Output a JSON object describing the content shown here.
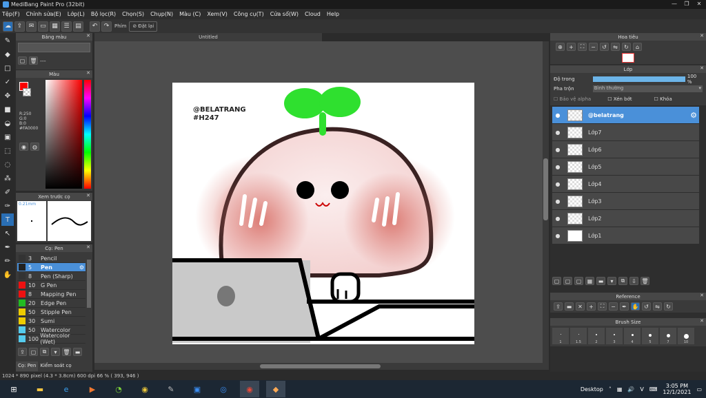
{
  "app": {
    "title": "MediBang Paint Pro (32bit)"
  },
  "menu": [
    "Tệp(F)",
    "Chỉnh sửa(E)",
    "Lớp(L)",
    "Bộ lọc(R)",
    "Chọn(S)",
    "Chụp(N)",
    "Màu (C)",
    "Xem(V)",
    "Công cụ(T)",
    "Cửa sổ(W)",
    "Cloud",
    "Help"
  ],
  "toolbar": {
    "phim_label": "Phím",
    "reset_label": "Đặt lại"
  },
  "document": {
    "tab_title": "Untitled"
  },
  "artwork": {
    "caption_line1": "@BELATRANG",
    "caption_line2": "#H247"
  },
  "panels": {
    "palette": {
      "title": "Bảng màu",
      "dash": "---"
    },
    "color": {
      "title": "Màu",
      "r": "R:250",
      "g": "G:0",
      "b": "B:0",
      "hex": "#FA0000",
      "main_color": "#fa0000"
    },
    "brush_preview": {
      "title": "Xem trước cọ",
      "size": "0.21mm"
    },
    "brush": {
      "title": "Cọ: Pen",
      "tab_brush": "Cọ: Pen",
      "tab_control": "Kiểm soát cọ",
      "items": [
        {
          "size": "3",
          "name": "Pencil",
          "color": "#333333"
        },
        {
          "size": "5",
          "name": "Pen",
          "color": "#222222"
        },
        {
          "size": "8",
          "name": "Pen (Sharp)",
          "color": "#333333"
        },
        {
          "size": "10",
          "name": "G Pen",
          "color": "#ee1111"
        },
        {
          "size": "8",
          "name": "Mapping Pen",
          "color": "#ee1111"
        },
        {
          "size": "20",
          "name": "Edge Pen",
          "color": "#22bb22"
        },
        {
          "size": "50",
          "name": "Stipple Pen",
          "color": "#eecc00"
        },
        {
          "size": "30",
          "name": "Sumi",
          "color": "#eecc00"
        },
        {
          "size": "50",
          "name": "Watercolor",
          "color": "#55ccee"
        },
        {
          "size": "100",
          "name": "Watercolor (Wet)",
          "color": "#55ccee"
        }
      ]
    },
    "navigator": {
      "title": "Hoa tiêu"
    },
    "layers": {
      "title": "Lớp",
      "opacity_label": "Độ trong",
      "opacity_value": "100 %",
      "opacity_fraction": 1.0,
      "blend_label": "Pha trộn",
      "blend_value": "Bình thường",
      "protect_alpha": "Bảo vệ alpha",
      "clipping": "Xén bớt",
      "lock": "Khóa",
      "items": [
        {
          "name": "@belatrang",
          "selected": true
        },
        {
          "name": "Lớp7"
        },
        {
          "name": "Lớp6"
        },
        {
          "name": "Lớp5"
        },
        {
          "name": "Lớp4"
        },
        {
          "name": "Lớp3"
        },
        {
          "name": "Lớp2"
        },
        {
          "name": "Lớp1"
        }
      ]
    },
    "reference": {
      "title": "Reference"
    },
    "brush_size": {
      "title": "Brush Size",
      "sizes": [
        "1",
        "1.5",
        "2",
        "3",
        "4",
        "5",
        "7",
        "10"
      ]
    }
  },
  "status": {
    "text": "1024 * 890 pixel  (4.3 * 3.8cm)  600 dpi  66 %  ( 393, 946 )"
  },
  "taskbar": {
    "desktop": "Desktop",
    "time": "3:05 PM",
    "date": "12/1/2021",
    "lang": "V"
  }
}
